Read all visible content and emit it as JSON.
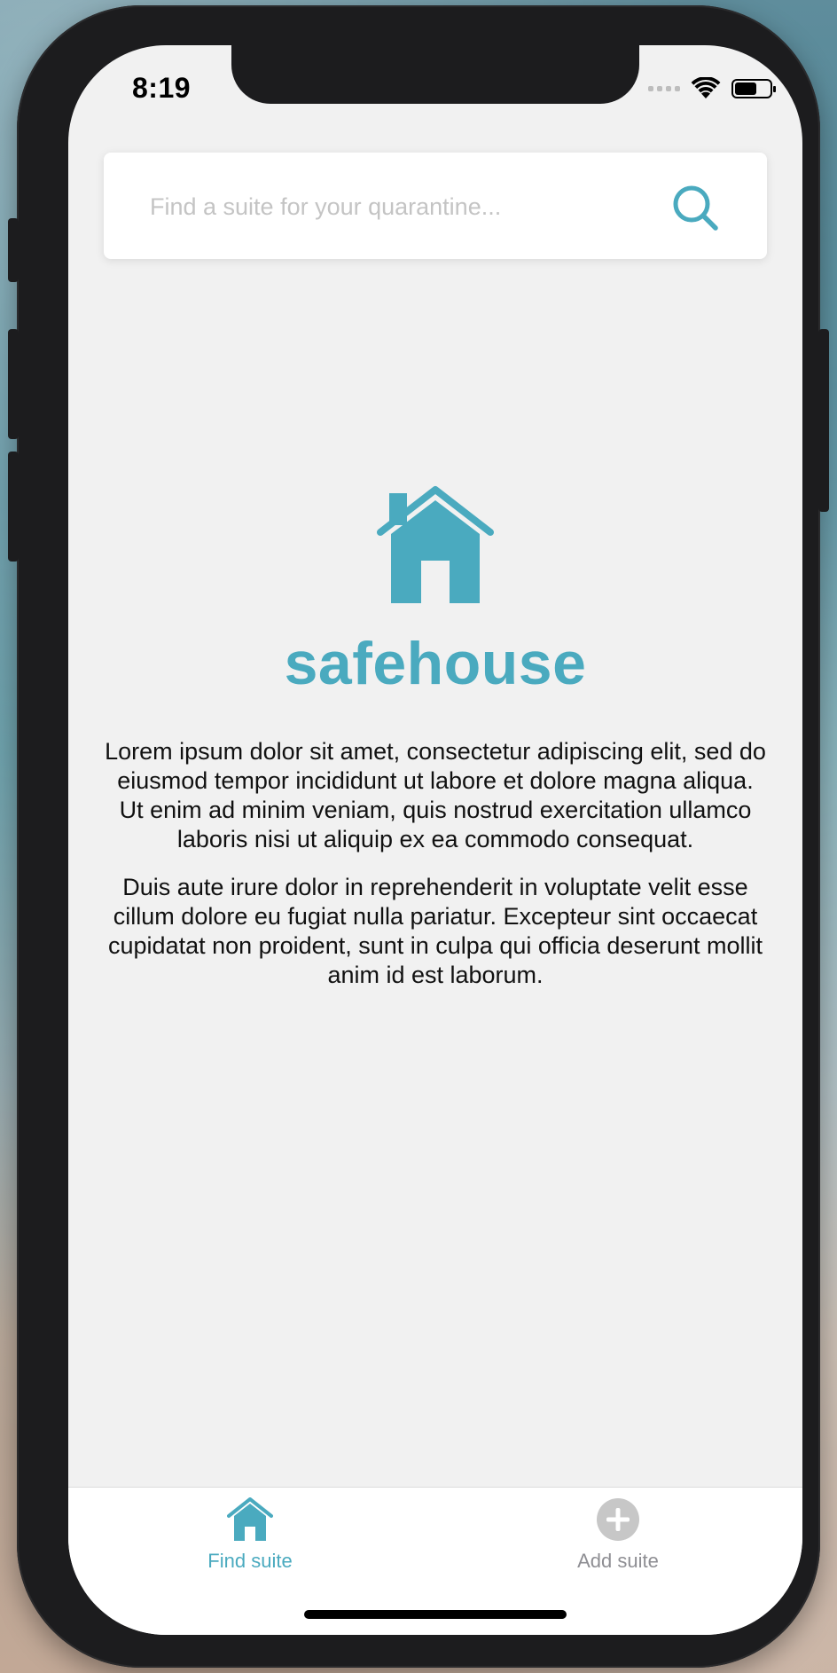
{
  "status_bar": {
    "time": "8:19"
  },
  "search": {
    "placeholder": "Find a suite for your quarantine...",
    "value": "",
    "icon": "search-icon"
  },
  "hero": {
    "icon": "house-icon",
    "title": "safehouse",
    "paragraphs": [
      "Lorem ipsum dolor sit amet, consectetur adipiscing elit, sed do eiusmod tempor incididunt ut labore et dolore magna aliqua. Ut enim ad minim veniam, quis nostrud exercitation ullamco laboris nisi ut aliquip ex ea commodo consequat.",
      "Duis aute irure dolor in reprehenderit in voluptate velit esse cillum dolore eu fugiat nulla pariatur. Excepteur sint occaecat cupidatat non proident, sunt in culpa qui officia deserunt mollit anim id est laborum."
    ]
  },
  "tabbar": {
    "tabs": [
      {
        "label": "Find suite",
        "icon": "house-icon",
        "active": true
      },
      {
        "label": "Add suite",
        "icon": "plus-circle-icon",
        "active": false
      }
    ]
  },
  "colors": {
    "accent": "#4aaabf",
    "inactive": "#8e8e93",
    "screen_bg": "#f1f1f1"
  }
}
